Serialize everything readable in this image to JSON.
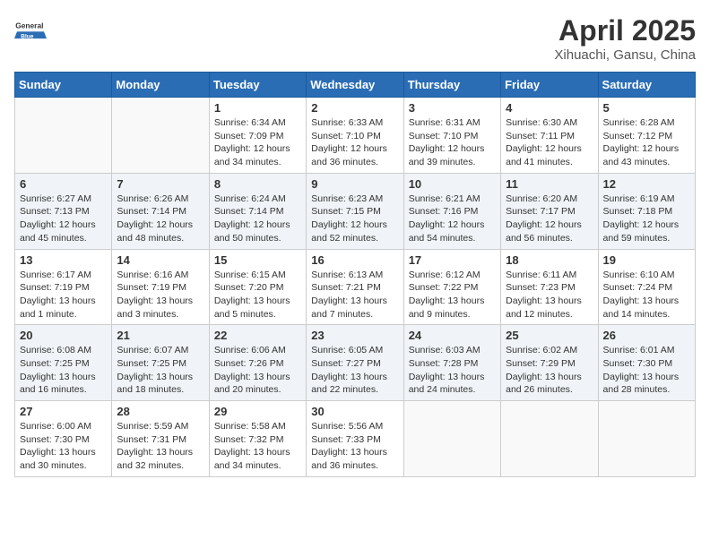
{
  "logo": {
    "general": "General",
    "blue": "Blue"
  },
  "title": "April 2025",
  "subtitle": "Xihuachi, Gansu, China",
  "days_of_week": [
    "Sunday",
    "Monday",
    "Tuesday",
    "Wednesday",
    "Thursday",
    "Friday",
    "Saturday"
  ],
  "weeks": [
    [
      {
        "day": "",
        "info": ""
      },
      {
        "day": "",
        "info": ""
      },
      {
        "day": "1",
        "info": "Sunrise: 6:34 AM\nSunset: 7:09 PM\nDaylight: 12 hours and 34 minutes."
      },
      {
        "day": "2",
        "info": "Sunrise: 6:33 AM\nSunset: 7:10 PM\nDaylight: 12 hours and 36 minutes."
      },
      {
        "day": "3",
        "info": "Sunrise: 6:31 AM\nSunset: 7:10 PM\nDaylight: 12 hours and 39 minutes."
      },
      {
        "day": "4",
        "info": "Sunrise: 6:30 AM\nSunset: 7:11 PM\nDaylight: 12 hours and 41 minutes."
      },
      {
        "day": "5",
        "info": "Sunrise: 6:28 AM\nSunset: 7:12 PM\nDaylight: 12 hours and 43 minutes."
      }
    ],
    [
      {
        "day": "6",
        "info": "Sunrise: 6:27 AM\nSunset: 7:13 PM\nDaylight: 12 hours and 45 minutes."
      },
      {
        "day": "7",
        "info": "Sunrise: 6:26 AM\nSunset: 7:14 PM\nDaylight: 12 hours and 48 minutes."
      },
      {
        "day": "8",
        "info": "Sunrise: 6:24 AM\nSunset: 7:14 PM\nDaylight: 12 hours and 50 minutes."
      },
      {
        "day": "9",
        "info": "Sunrise: 6:23 AM\nSunset: 7:15 PM\nDaylight: 12 hours and 52 minutes."
      },
      {
        "day": "10",
        "info": "Sunrise: 6:21 AM\nSunset: 7:16 PM\nDaylight: 12 hours and 54 minutes."
      },
      {
        "day": "11",
        "info": "Sunrise: 6:20 AM\nSunset: 7:17 PM\nDaylight: 12 hours and 56 minutes."
      },
      {
        "day": "12",
        "info": "Sunrise: 6:19 AM\nSunset: 7:18 PM\nDaylight: 12 hours and 59 minutes."
      }
    ],
    [
      {
        "day": "13",
        "info": "Sunrise: 6:17 AM\nSunset: 7:19 PM\nDaylight: 13 hours and 1 minute."
      },
      {
        "day": "14",
        "info": "Sunrise: 6:16 AM\nSunset: 7:19 PM\nDaylight: 13 hours and 3 minutes."
      },
      {
        "day": "15",
        "info": "Sunrise: 6:15 AM\nSunset: 7:20 PM\nDaylight: 13 hours and 5 minutes."
      },
      {
        "day": "16",
        "info": "Sunrise: 6:13 AM\nSunset: 7:21 PM\nDaylight: 13 hours and 7 minutes."
      },
      {
        "day": "17",
        "info": "Sunrise: 6:12 AM\nSunset: 7:22 PM\nDaylight: 13 hours and 9 minutes."
      },
      {
        "day": "18",
        "info": "Sunrise: 6:11 AM\nSunset: 7:23 PM\nDaylight: 13 hours and 12 minutes."
      },
      {
        "day": "19",
        "info": "Sunrise: 6:10 AM\nSunset: 7:24 PM\nDaylight: 13 hours and 14 minutes."
      }
    ],
    [
      {
        "day": "20",
        "info": "Sunrise: 6:08 AM\nSunset: 7:25 PM\nDaylight: 13 hours and 16 minutes."
      },
      {
        "day": "21",
        "info": "Sunrise: 6:07 AM\nSunset: 7:25 PM\nDaylight: 13 hours and 18 minutes."
      },
      {
        "day": "22",
        "info": "Sunrise: 6:06 AM\nSunset: 7:26 PM\nDaylight: 13 hours and 20 minutes."
      },
      {
        "day": "23",
        "info": "Sunrise: 6:05 AM\nSunset: 7:27 PM\nDaylight: 13 hours and 22 minutes."
      },
      {
        "day": "24",
        "info": "Sunrise: 6:03 AM\nSunset: 7:28 PM\nDaylight: 13 hours and 24 minutes."
      },
      {
        "day": "25",
        "info": "Sunrise: 6:02 AM\nSunset: 7:29 PM\nDaylight: 13 hours and 26 minutes."
      },
      {
        "day": "26",
        "info": "Sunrise: 6:01 AM\nSunset: 7:30 PM\nDaylight: 13 hours and 28 minutes."
      }
    ],
    [
      {
        "day": "27",
        "info": "Sunrise: 6:00 AM\nSunset: 7:30 PM\nDaylight: 13 hours and 30 minutes."
      },
      {
        "day": "28",
        "info": "Sunrise: 5:59 AM\nSunset: 7:31 PM\nDaylight: 13 hours and 32 minutes."
      },
      {
        "day": "29",
        "info": "Sunrise: 5:58 AM\nSunset: 7:32 PM\nDaylight: 13 hours and 34 minutes."
      },
      {
        "day": "30",
        "info": "Sunrise: 5:56 AM\nSunset: 7:33 PM\nDaylight: 13 hours and 36 minutes."
      },
      {
        "day": "",
        "info": ""
      },
      {
        "day": "",
        "info": ""
      },
      {
        "day": "",
        "info": ""
      }
    ]
  ]
}
